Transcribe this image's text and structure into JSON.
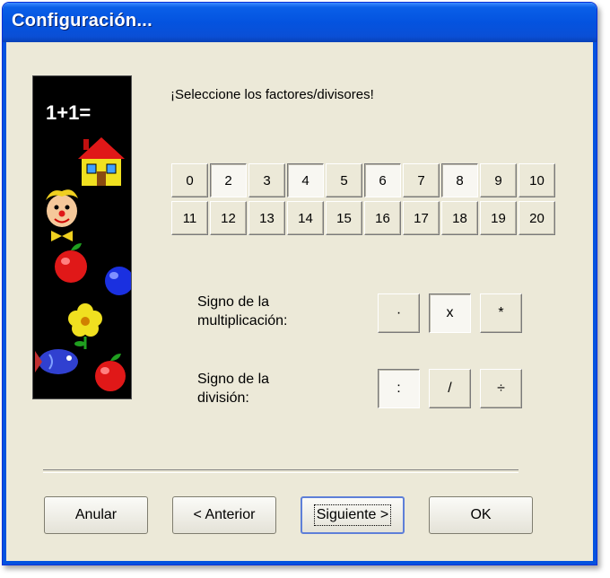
{
  "window": {
    "title": "Configuración..."
  },
  "prompt": "¡Seleccione los factores/divisores!",
  "picture": {
    "text": "1+1="
  },
  "factors": [
    {
      "label": "0",
      "selected": false
    },
    {
      "label": "2",
      "selected": true
    },
    {
      "label": "3",
      "selected": false
    },
    {
      "label": "4",
      "selected": true
    },
    {
      "label": "5",
      "selected": false
    },
    {
      "label": "6",
      "selected": true
    },
    {
      "label": "7",
      "selected": false
    },
    {
      "label": "8",
      "selected": true
    },
    {
      "label": "9",
      "selected": false
    },
    {
      "label": "10",
      "selected": false
    },
    {
      "label": "11",
      "selected": false
    },
    {
      "label": "12",
      "selected": false
    },
    {
      "label": "13",
      "selected": false
    },
    {
      "label": "14",
      "selected": false
    },
    {
      "label": "15",
      "selected": false
    },
    {
      "label": "16",
      "selected": false
    },
    {
      "label": "17",
      "selected": false
    },
    {
      "label": "18",
      "selected": false
    },
    {
      "label": "19",
      "selected": false
    },
    {
      "label": "20",
      "selected": false
    }
  ],
  "multiplication": {
    "label_line1": "Signo de la",
    "label_line2": "multiplicación:",
    "options": [
      {
        "symbol": "·",
        "selected": false
      },
      {
        "symbol": "x",
        "selected": true
      },
      {
        "symbol": "*",
        "selected": false
      }
    ]
  },
  "division": {
    "label_line1": "Signo de la",
    "label_line2": "división:",
    "options": [
      {
        "symbol": ":",
        "selected": true
      },
      {
        "symbol": "/",
        "selected": false
      },
      {
        "symbol": "÷",
        "selected": false
      }
    ]
  },
  "buttons": {
    "cancel": "Anular",
    "back": "< Anterior",
    "next": "Siguiente >",
    "ok": "OK"
  }
}
